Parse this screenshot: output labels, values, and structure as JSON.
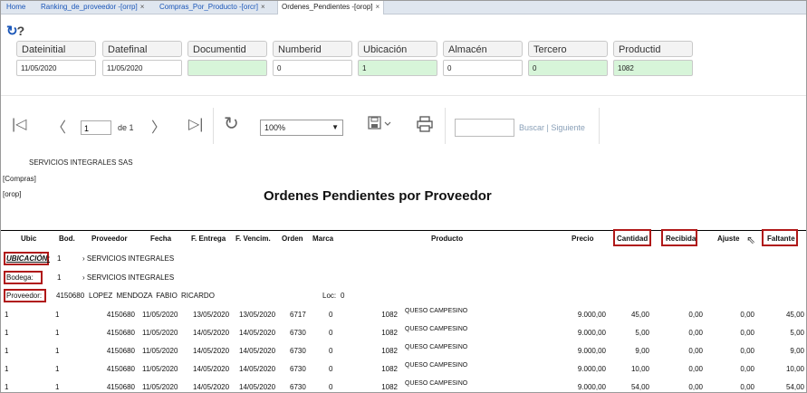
{
  "tabs": [
    {
      "label": "Home"
    },
    {
      "label": "Ranking_de_proveedor -[orrp]"
    },
    {
      "label": "Compras_Por_Producto -[orcr]"
    },
    {
      "label": "Ordenes_Pendientes -[orop]"
    }
  ],
  "close_glyph": "×",
  "toolbar_icons": [
    "refresh-icon",
    "help-icon"
  ],
  "params": [
    {
      "label": "Dateinitial",
      "value": "11/05/2020",
      "highlight": false
    },
    {
      "label": "Datefinal",
      "value": "11/05/2020",
      "highlight": false
    },
    {
      "label": "Documentid",
      "value": "",
      "highlight": true
    },
    {
      "label": "Numberid",
      "value": "0",
      "highlight": false
    },
    {
      "label": "Ubicación",
      "value": "1",
      "highlight": true
    },
    {
      "label": "Almacén",
      "value": "0",
      "highlight": false
    },
    {
      "label": "Tercero",
      "value": "0",
      "highlight": true
    },
    {
      "label": "Productid",
      "value": "1082",
      "highlight": true
    }
  ],
  "viewer": {
    "page": "1",
    "of_label": "de 1",
    "zoom": "100%",
    "search_label": "Buscar | Siguiente"
  },
  "report": {
    "company": "SERVICIOS INTEGRALES SAS",
    "module": "[Compras]",
    "code": "[orop]",
    "title": "Ordenes Pendientes por Proveedor",
    "columns": [
      "Ubic",
      "Bod.",
      "Proveedor",
      "Fecha",
      "F. Entrega",
      "F. Vencim.",
      "Orden",
      "Marca",
      "Producto",
      "Precio",
      "Cantidad",
      "Recibida",
      "Ajuste",
      "Faltante"
    ],
    "group_ubicacion_label": "UBICACIÓN:",
    "group_ubicacion_value": "1",
    "group_ubicacion_name": "› SERVICIOS INTEGRALES",
    "group_bodega_label": "Bodega:",
    "group_bodega_value": "1",
    "group_bodega_name": "› SERVICIOS INTEGRALES",
    "group_proveedor_label": "Proveedor:",
    "group_proveedor_id": "4150680",
    "group_proveedor_name": "LOPEZ MENDOZA FABIO RICARDO",
    "loc_label": "Loc:",
    "loc_value": "0",
    "rows": [
      [
        "1",
        "1",
        "4150680",
        "11/05/2020",
        "13/05/2020",
        "13/05/2020",
        "6717",
        "0",
        "1082",
        "QUESO CAMPESINO",
        "9.000,00",
        "45,00",
        "0,00",
        "0,00",
        "45,00"
      ],
      [
        "1",
        "1",
        "4150680",
        "11/05/2020",
        "14/05/2020",
        "14/05/2020",
        "6730",
        "0",
        "1082",
        "QUESO CAMPESINO",
        "9.000,00",
        "5,00",
        "0,00",
        "0,00",
        "5,00"
      ],
      [
        "1",
        "1",
        "4150680",
        "11/05/2020",
        "14/05/2020",
        "14/05/2020",
        "6730",
        "0",
        "1082",
        "QUESO CAMPESINO",
        "9.000,00",
        "9,00",
        "0,00",
        "0,00",
        "9,00"
      ],
      [
        "1",
        "1",
        "4150680",
        "11/05/2020",
        "14/05/2020",
        "14/05/2020",
        "6730",
        "0",
        "1082",
        "QUESO CAMPESINO",
        "9.000,00",
        "10,00",
        "0,00",
        "0,00",
        "10,00"
      ],
      [
        "1",
        "1",
        "4150680",
        "11/05/2020",
        "14/05/2020",
        "14/05/2020",
        "6730",
        "0",
        "1082",
        "QUESO CAMPESINO",
        "9.000,00",
        "54,00",
        "0,00",
        "0,00",
        "54,00"
      ]
    ]
  }
}
